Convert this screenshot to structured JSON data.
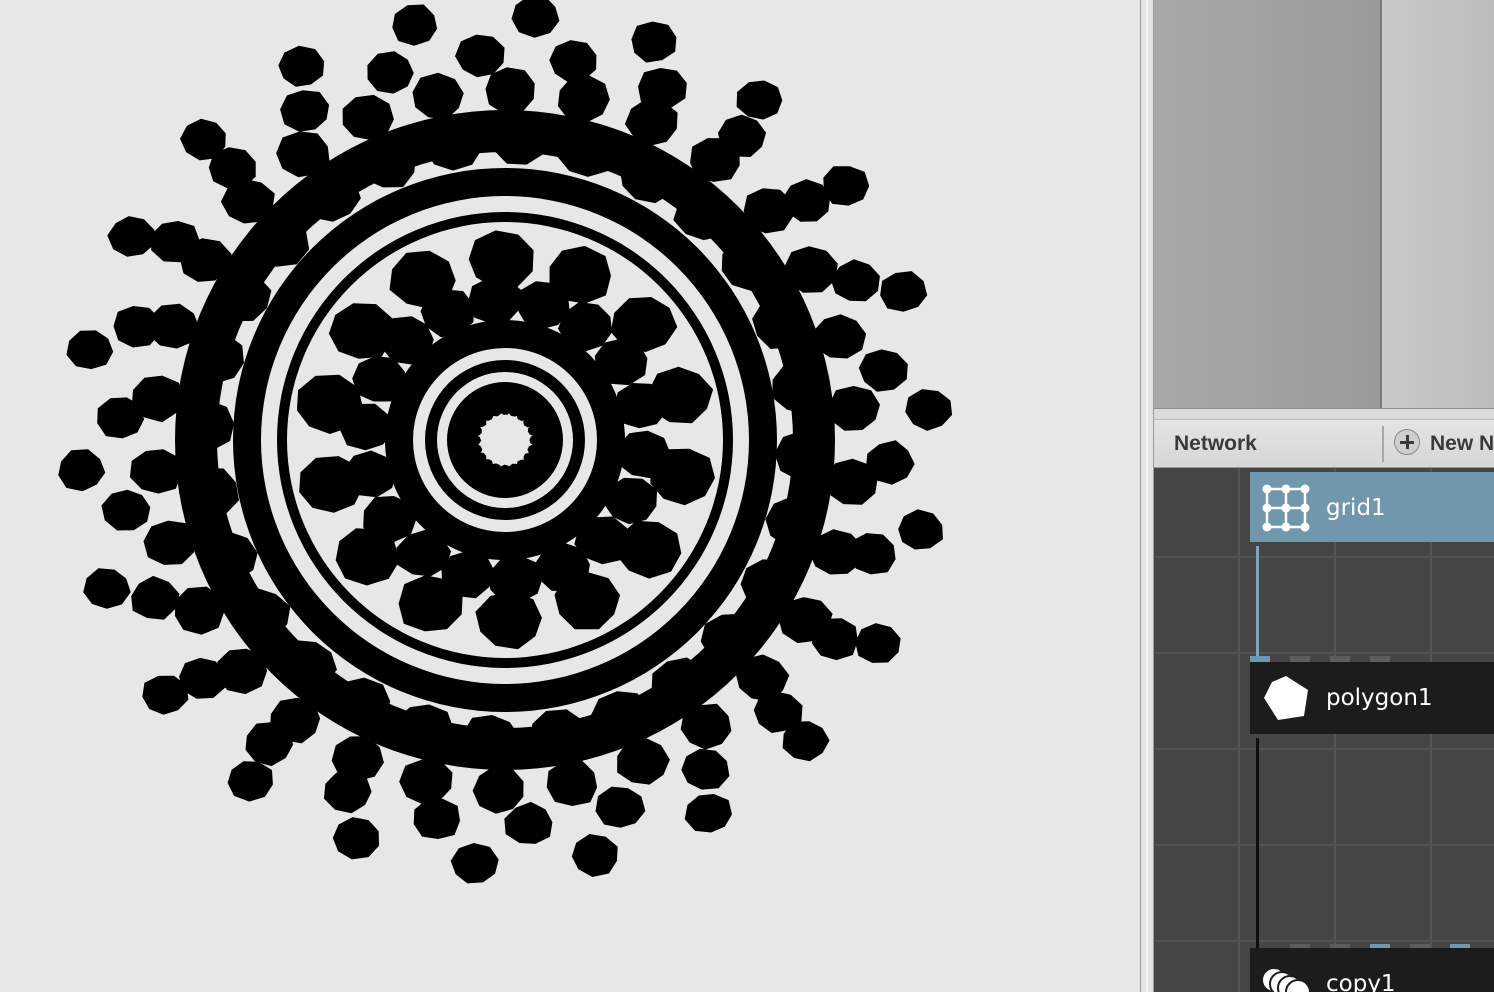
{
  "viewport": {
    "description_free": true,
    "shape_color": "#000000",
    "background_color": "#e7e7e7"
  },
  "network_panel": {
    "tabs": [
      {
        "label": "Network",
        "active": true
      },
      {
        "label": "New N",
        "icon": "plus-circle-icon"
      }
    ],
    "nodes": [
      {
        "name": "grid1",
        "icon": "grid-icon",
        "selected": true,
        "color": "#7197ad"
      },
      {
        "name": "polygon1",
        "icon": "polygon-icon",
        "selected": false,
        "color": "#1c1c1c"
      },
      {
        "name": "copy1",
        "icon": "copy-stack-icon",
        "selected": false,
        "color": "#1c1c1c"
      }
    ]
  }
}
